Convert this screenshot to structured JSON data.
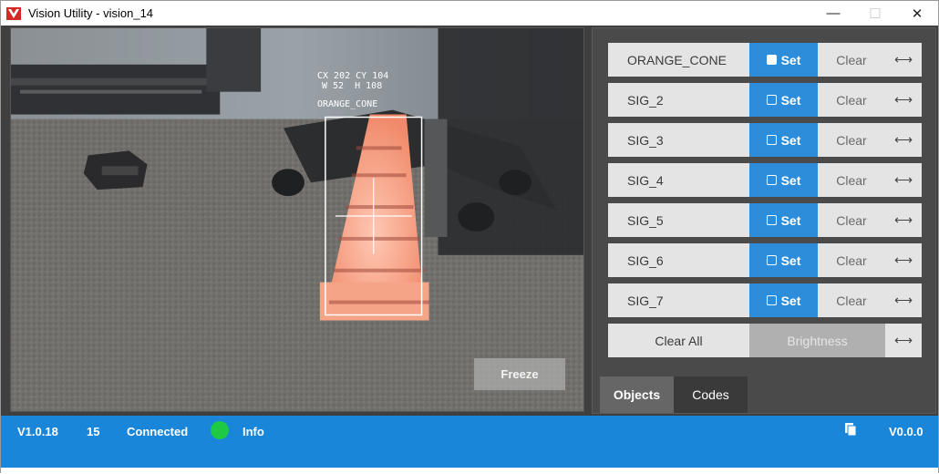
{
  "window": {
    "title": "Vision Utility - vision_14",
    "controls": {
      "minimize": "—",
      "maximize": "☐",
      "close": "✕"
    }
  },
  "camera": {
    "overlay_line1": "CX 202 CY 104",
    "overlay_line2": "W 52  H 108",
    "object_label": "ORANGE_CONE",
    "freeze_label": "Freeze"
  },
  "signatures": [
    {
      "name": "ORANGE_CONE",
      "set_label": "Set",
      "clear_label": "Clear",
      "arrow": "⟷",
      "set_checked": true
    },
    {
      "name": "SIG_2",
      "set_label": "Set",
      "clear_label": "Clear",
      "arrow": "⟷",
      "set_checked": false
    },
    {
      "name": "SIG_3",
      "set_label": "Set",
      "clear_label": "Clear",
      "arrow": "⟷",
      "set_checked": false
    },
    {
      "name": "SIG_4",
      "set_label": "Set",
      "clear_label": "Clear",
      "arrow": "⟷",
      "set_checked": false
    },
    {
      "name": "SIG_5",
      "set_label": "Set",
      "clear_label": "Clear",
      "arrow": "⟷",
      "set_checked": false
    },
    {
      "name": "SIG_6",
      "set_label": "Set",
      "clear_label": "Clear",
      "arrow": "⟷",
      "set_checked": false
    },
    {
      "name": "SIG_7",
      "set_label": "Set",
      "clear_label": "Clear",
      "arrow": "⟷",
      "set_checked": false
    }
  ],
  "bottom_controls": {
    "clear_all_label": "Clear All",
    "brightness_label": "Brightness",
    "arrow": "⟷"
  },
  "tabs": [
    {
      "label": "Objects",
      "active": true
    },
    {
      "label": "Codes",
      "active": false
    }
  ],
  "status": {
    "version": "V1.0.18",
    "fps": "15",
    "connection": "Connected",
    "info_label": "Info",
    "firmware": "V0.0.0",
    "connection_color": "#1ec943"
  },
  "colors": {
    "accent": "#2e8ddb",
    "statusbar": "#1a86d9",
    "logo": "#d42a27"
  },
  "icons": {
    "app_logo": "vex-logo-icon",
    "copy": "copy-icon",
    "status_indicator": "status-dot-icon"
  }
}
